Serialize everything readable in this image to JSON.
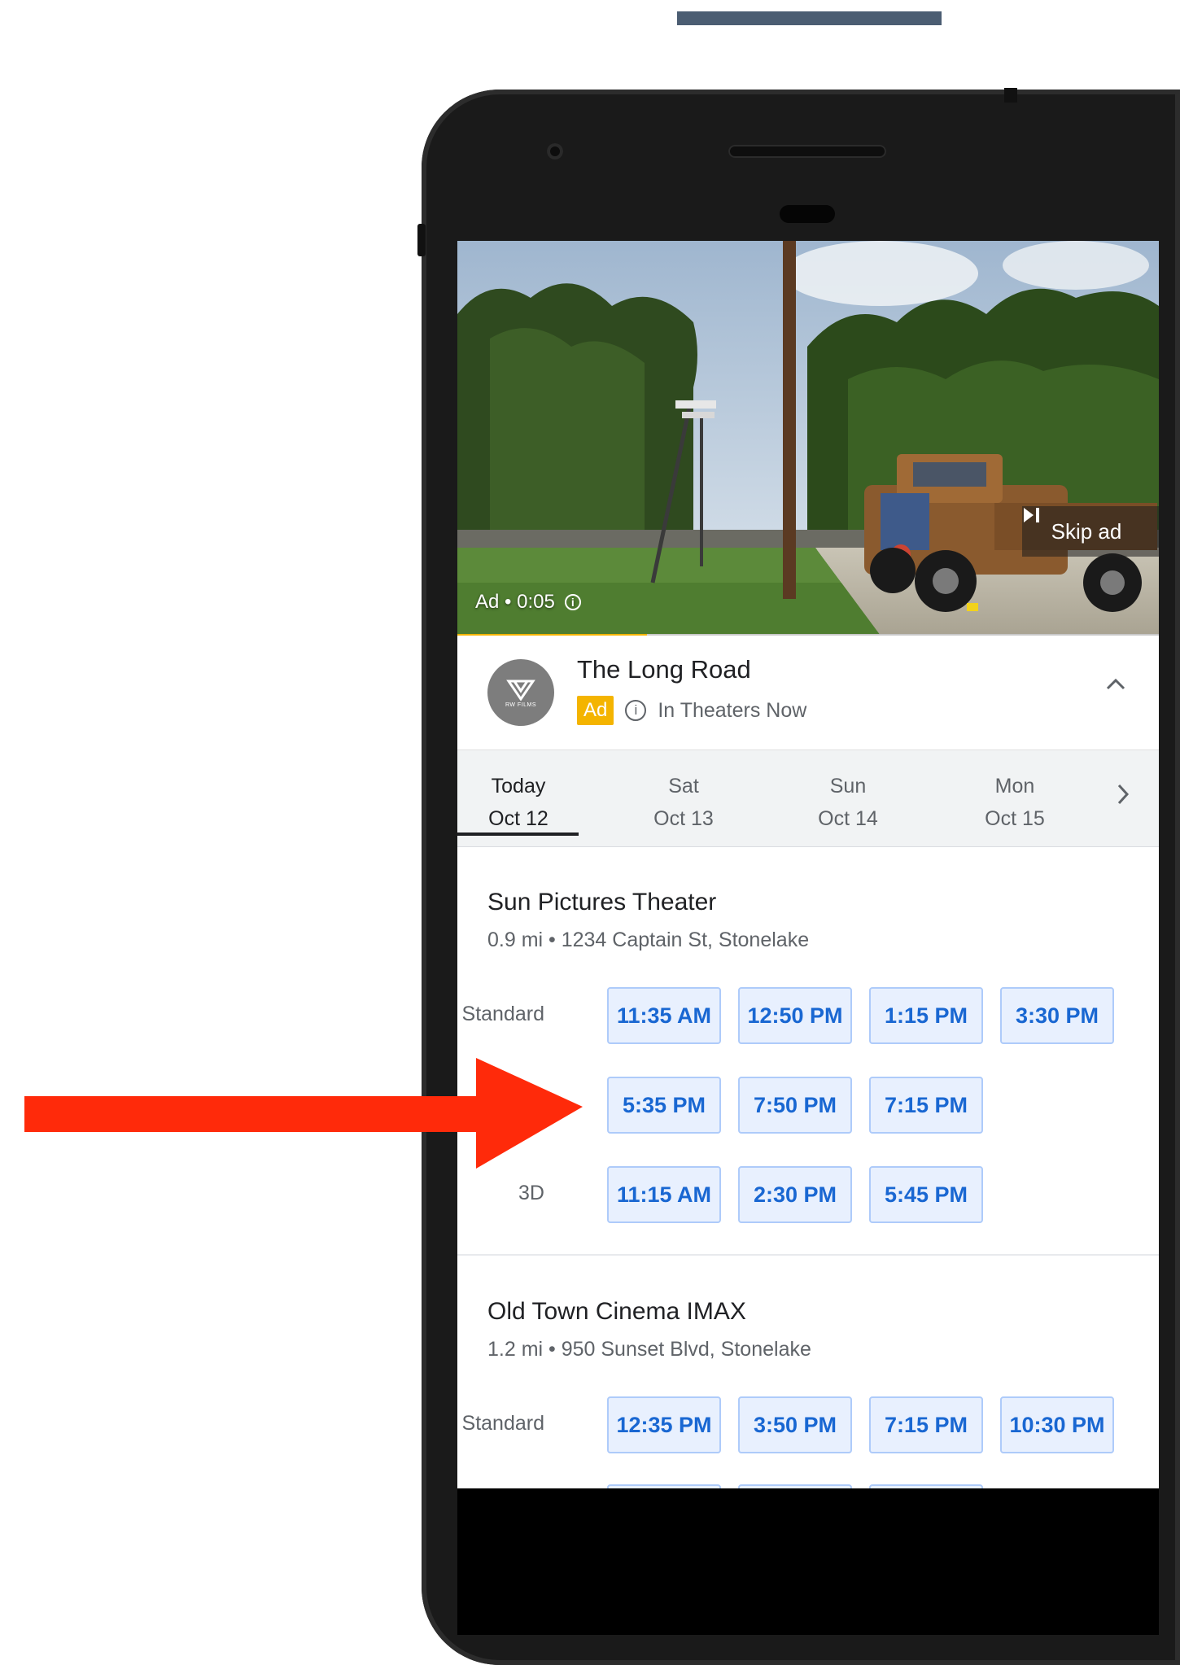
{
  "video": {
    "ad_time": "Ad • 0:05",
    "skip_label": "Skip ad",
    "progress": 0.27
  },
  "ad": {
    "logo_text": "RW FILMS",
    "title": "The Long Road",
    "badge": "Ad",
    "tagline": "In Theaters Now"
  },
  "dates": [
    {
      "day": "Today",
      "date": "Oct 12",
      "active": true
    },
    {
      "day": "Sat",
      "date": "Oct 13",
      "active": false
    },
    {
      "day": "Sun",
      "date": "Oct 14",
      "active": false
    },
    {
      "day": "Mon",
      "date": "Oct 15",
      "active": false
    }
  ],
  "theaters": [
    {
      "name": "Sun Pictures Theater",
      "address": "0.9 mi • 1234 Captain St, Stonelake",
      "formats": [
        {
          "label": "Standard",
          "times": [
            "11:35 AM",
            "12:50 PM",
            "1:15 PM",
            "3:30 PM",
            "5:35 PM",
            "7:50 PM",
            "7:15 PM"
          ]
        },
        {
          "label": "3D",
          "times": [
            "11:15 AM",
            "2:30 PM",
            "5:45 PM"
          ]
        }
      ]
    },
    {
      "name": "Old Town Cinema IMAX",
      "address": "1.2 mi • 950 Sunset Blvd, Stonelake",
      "formats": [
        {
          "label": "Standard",
          "times": [
            "12:35 PM",
            "3:50 PM",
            "7:15 PM",
            "10:30 PM"
          ]
        }
      ]
    }
  ],
  "colors": {
    "accent": "#1967d2",
    "ad_yellow": "#f4b400",
    "arrow": "#ff2a0a"
  }
}
